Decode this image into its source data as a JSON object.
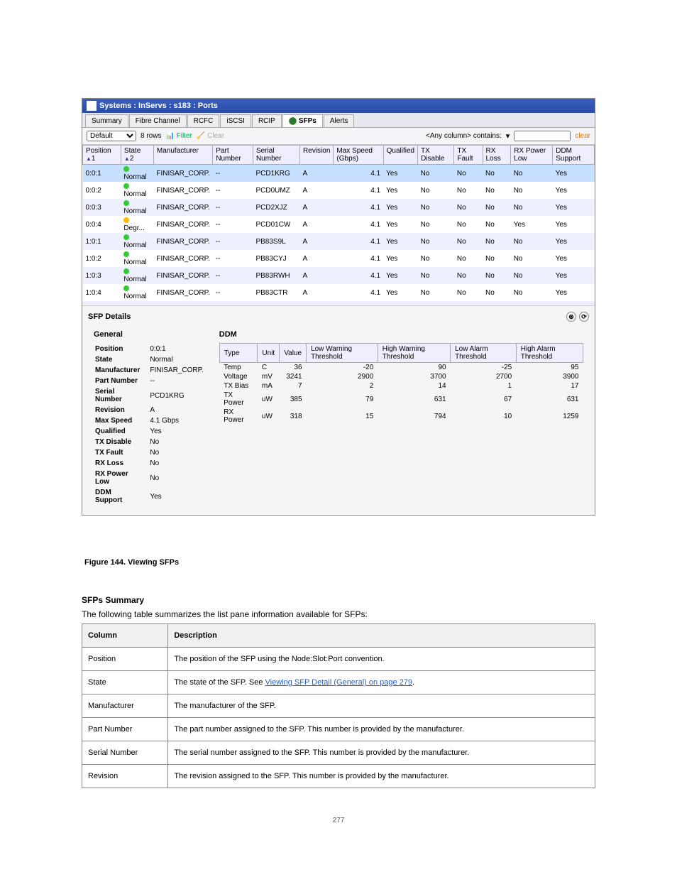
{
  "window_title": "Systems : InServs : s183 : Ports",
  "tabs": [
    "Summary",
    "Fibre Channel",
    "RCFC",
    "iSCSI",
    "RCIP",
    "SFPs",
    "Alerts"
  ],
  "active_tab": "SFPs",
  "view_select": "Default",
  "rows_label": "8 rows",
  "filter_label": "Filter",
  "clear_label": "Clear",
  "filter_col_label": "<Any column> contains:",
  "filter_placeholder": "",
  "clear_right": "clear",
  "columns": [
    "Position",
    "State",
    "Manufacturer",
    "Part Number",
    "Serial Number",
    "Revision",
    "Max Speed (Gbps)",
    "Qualified",
    "TX Disable",
    "TX Fault",
    "RX Loss",
    "RX Power Low",
    "DDM Support"
  ],
  "sort1": "1",
  "sort2": "2",
  "rows": [
    {
      "pos": "0:0:1",
      "state": "Normal",
      "dot": "normal",
      "mfr": "FINISAR_CORP.",
      "pn": "--",
      "sn": "PCD1KRG",
      "rev": "A",
      "spd": "4.1",
      "qual": "Yes",
      "txd": "No",
      "txf": "No",
      "rxl": "No",
      "rxp": "No",
      "ddm": "Yes",
      "sel": true
    },
    {
      "pos": "0:0:2",
      "state": "Normal",
      "dot": "normal",
      "mfr": "FINISAR_CORP.",
      "pn": "--",
      "sn": "PCD0UMZ",
      "rev": "A",
      "spd": "4.1",
      "qual": "Yes",
      "txd": "No",
      "txf": "No",
      "rxl": "No",
      "rxp": "No",
      "ddm": "Yes"
    },
    {
      "pos": "0:0:3",
      "state": "Normal",
      "dot": "normal",
      "mfr": "FINISAR_CORP.",
      "pn": "--",
      "sn": "PCD2XJZ",
      "rev": "A",
      "spd": "4.1",
      "qual": "Yes",
      "txd": "No",
      "txf": "No",
      "rxl": "No",
      "rxp": "No",
      "ddm": "Yes"
    },
    {
      "pos": "0:0:4",
      "state": "Degr...",
      "dot": "degraded",
      "mfr": "FINISAR_CORP.",
      "pn": "--",
      "sn": "PCD01CW",
      "rev": "A",
      "spd": "4.1",
      "qual": "Yes",
      "txd": "No",
      "txf": "No",
      "rxl": "No",
      "rxp": "Yes",
      "ddm": "Yes"
    },
    {
      "pos": "1:0:1",
      "state": "Normal",
      "dot": "normal",
      "mfr": "FINISAR_CORP.",
      "pn": "--",
      "sn": "PB83S9L",
      "rev": "A",
      "spd": "4.1",
      "qual": "Yes",
      "txd": "No",
      "txf": "No",
      "rxl": "No",
      "rxp": "No",
      "ddm": "Yes"
    },
    {
      "pos": "1:0:2",
      "state": "Normal",
      "dot": "normal",
      "mfr": "FINISAR_CORP.",
      "pn": "--",
      "sn": "PB83CYJ",
      "rev": "A",
      "spd": "4.1",
      "qual": "Yes",
      "txd": "No",
      "txf": "No",
      "rxl": "No",
      "rxp": "No",
      "ddm": "Yes"
    },
    {
      "pos": "1:0:3",
      "state": "Normal",
      "dot": "normal",
      "mfr": "FINISAR_CORP.",
      "pn": "--",
      "sn": "PB83RWH",
      "rev": "A",
      "spd": "4.1",
      "qual": "Yes",
      "txd": "No",
      "txf": "No",
      "rxl": "No",
      "rxp": "No",
      "ddm": "Yes"
    },
    {
      "pos": "1:0:4",
      "state": "Normal",
      "dot": "normal",
      "mfr": "FINISAR_CORP.",
      "pn": "--",
      "sn": "PB83CTR",
      "rev": "A",
      "spd": "4.1",
      "qual": "Yes",
      "txd": "No",
      "txf": "No",
      "rxl": "No",
      "rxp": "No",
      "ddm": "Yes"
    }
  ],
  "details_title": "SFP Details",
  "general_title": "General",
  "ddm_title": "DDM",
  "general": [
    {
      "label": "Position",
      "value": "0:0:1"
    },
    {
      "label": "State",
      "value": "Normal"
    },
    {
      "label": "Manufacturer",
      "value": "FINISAR_CORP."
    },
    {
      "label": "Part Number",
      "value": "--"
    },
    {
      "label": "Serial Number",
      "value": "PCD1KRG"
    },
    {
      "label": "Revision",
      "value": "A"
    },
    {
      "label": "Max Speed",
      "value": "4.1 Gbps"
    },
    {
      "label": "Qualified",
      "value": "Yes"
    },
    {
      "label": "TX Disable",
      "value": "No"
    },
    {
      "label": "TX Fault",
      "value": "No"
    },
    {
      "label": "RX Loss",
      "value": "No"
    },
    {
      "label": "RX Power Low",
      "value": "No"
    },
    {
      "label": "DDM Support",
      "value": "Yes"
    }
  ],
  "ddm_cols": [
    "Type",
    "Unit",
    "Value",
    "Low Warning Threshold",
    "High Warning Threshold",
    "Low Alarm Threshold",
    "High Alarm Threshold"
  ],
  "ddm_rows": [
    {
      "type": "Temp",
      "unit": "C",
      "value": "36",
      "lw": "-20",
      "hw": "90",
      "la": "-25",
      "ha": "95"
    },
    {
      "type": "Voltage",
      "unit": "mV",
      "value": "3241",
      "lw": "2900",
      "hw": "3700",
      "la": "2700",
      "ha": "3900"
    },
    {
      "type": "TX Bias",
      "unit": "mA",
      "value": "7",
      "lw": "2",
      "hw": "14",
      "la": "1",
      "ha": "17"
    },
    {
      "type": "TX Power",
      "unit": "uW",
      "value": "385",
      "lw": "79",
      "hw": "631",
      "la": "67",
      "ha": "631"
    },
    {
      "type": "RX Power",
      "unit": "uW",
      "value": "318",
      "lw": "15",
      "hw": "794",
      "la": "10",
      "ha": "1259"
    }
  ],
  "chart_data": {
    "type": "table",
    "title": "DDM",
    "categories": [
      "Temp",
      "Voltage",
      "TX Bias",
      "TX Power",
      "RX Power"
    ],
    "series": [
      {
        "name": "Value",
        "values": [
          36,
          3241,
          7,
          385,
          318
        ]
      },
      {
        "name": "Low Warning Threshold",
        "values": [
          -20,
          2900,
          2,
          79,
          15
        ]
      },
      {
        "name": "High Warning Threshold",
        "values": [
          90,
          3700,
          14,
          631,
          794
        ]
      },
      {
        "name": "Low Alarm Threshold",
        "values": [
          -25,
          2700,
          1,
          67,
          10
        ]
      },
      {
        "name": "High Alarm Threshold",
        "values": [
          95,
          3900,
          17,
          631,
          1259
        ]
      }
    ]
  },
  "fig_caption": "Figure 144. Viewing SFPs",
  "doc_heading_a": "SFPs Summary",
  "doc_intro": "The following table summarizes the list pane information available for SFPs:",
  "doc_table": [
    {
      "col": "Column",
      "desc": "Description"
    },
    {
      "col": "Position",
      "desc": "The position of the SFP using the Node:Slot:Port convention."
    },
    {
      "col": "State",
      "desc_prefix": "The state of the SFP. See ",
      "link": "Viewing SFP Detail (General) on page 279",
      "desc_suffix": "."
    },
    {
      "col": "Manufacturer",
      "desc": "The manufacturer of the SFP."
    },
    {
      "col": "Part Number",
      "desc": "The part number assigned to the SFP. This number is provided by the manufacturer."
    },
    {
      "col": "Serial Number",
      "desc": "The serial number assigned to the SFP. This number is provided by the manufacturer."
    },
    {
      "col": "Revision",
      "desc": "The revision assigned to the SFP. This number is provided by the manufacturer."
    }
  ],
  "page_number": "277"
}
